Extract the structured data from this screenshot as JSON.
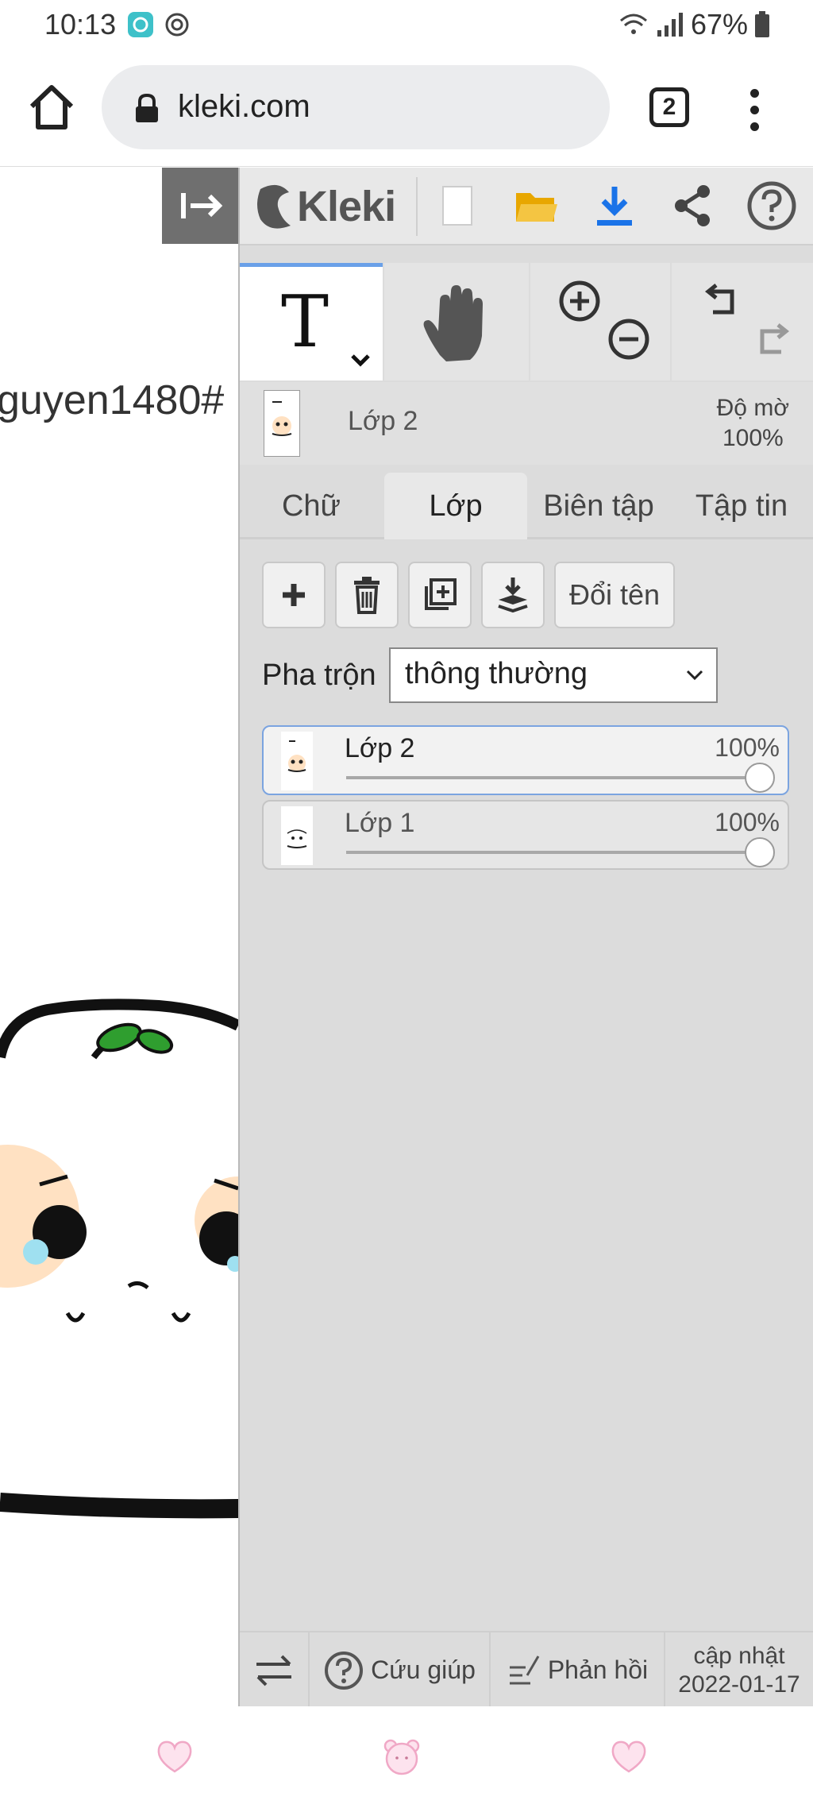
{
  "status_bar": {
    "time": "10:13",
    "battery": "67%"
  },
  "browser": {
    "url": "kleki.com",
    "tab_count": "2"
  },
  "canvas": {
    "text": "guyen1480#"
  },
  "app": {
    "logo": "Kleki"
  },
  "current_layer": {
    "name": "Lớp 2",
    "opacity_label": "Độ mờ",
    "opacity_value": "100%"
  },
  "tabs": [
    {
      "label": "Chữ"
    },
    {
      "label": "Lớp"
    },
    {
      "label": "Biên tập"
    },
    {
      "label": "Tập tin"
    }
  ],
  "layer_actions": {
    "rename": "Đổi tên"
  },
  "blend": {
    "label": "Pha trộn",
    "value": "thông thường"
  },
  "layers": [
    {
      "name": "Lớp 2",
      "opacity": "100%",
      "opacity_fraction": 1.0,
      "selected": true
    },
    {
      "name": "Lớp 1",
      "opacity": "100%",
      "opacity_fraction": 1.0,
      "selected": false
    }
  ],
  "footer": {
    "help": "Cứu giúp",
    "feedback": "Phản hồi",
    "update_line1": "cập nhật",
    "update_line2": "2022-01-17"
  },
  "colors": {
    "accent_blue": "#1a73e8",
    "folder_yellow": "#f4b400",
    "panel_bg": "#dcdcdc"
  }
}
